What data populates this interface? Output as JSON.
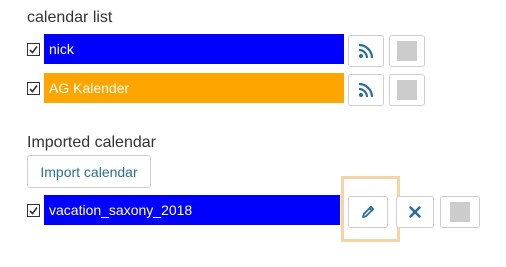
{
  "calendar_list": {
    "heading": "calendar list",
    "items": [
      {
        "name": "nick",
        "color": "#0000ff",
        "checked": true
      },
      {
        "name": "AG Kalender",
        "color": "#ffa500",
        "checked": true
      }
    ]
  },
  "imported": {
    "heading": "Imported calendar",
    "import_button": "Import calendar",
    "items": [
      {
        "name": "vacation_saxony_2018",
        "color": "#0000ff",
        "checked": true
      }
    ]
  },
  "icons": {
    "rss": "rss-icon",
    "pencil": "pencil-icon",
    "close": "close-icon"
  },
  "colors": {
    "icon_accent": "#2a6f9b",
    "highlight_border": "#f5d3a8",
    "gray_square": "#cccccc"
  }
}
